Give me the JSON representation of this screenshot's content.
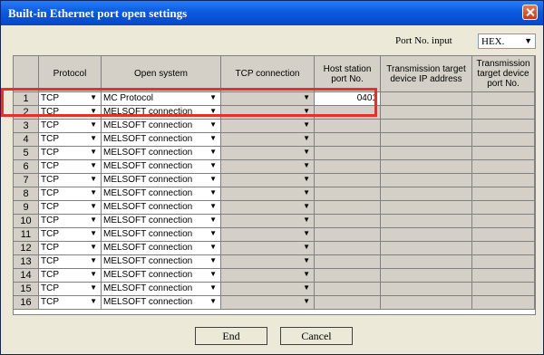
{
  "window": {
    "title": "Built-in Ethernet port open settings"
  },
  "port_no_input": {
    "label": "Port No. input",
    "value": "HEX."
  },
  "columns": [
    "",
    "Protocol",
    "Open system",
    "TCP connection",
    "Host station port No.",
    "Transmission target device IP address",
    "Transmission target device port No."
  ],
  "rows": [
    {
      "num": "1",
      "protocol": "TCP",
      "open_system": "MC Protocol",
      "tcp_connection": "",
      "host_port": "0401"
    },
    {
      "num": "2",
      "protocol": "TCP",
      "open_system": "MELSOFT connection",
      "tcp_connection": "",
      "host_port": ""
    },
    {
      "num": "3",
      "protocol": "TCP",
      "open_system": "MELSOFT connection",
      "tcp_connection": "",
      "host_port": ""
    },
    {
      "num": "4",
      "protocol": "TCP",
      "open_system": "MELSOFT connection",
      "tcp_connection": "",
      "host_port": ""
    },
    {
      "num": "5",
      "protocol": "TCP",
      "open_system": "MELSOFT connection",
      "tcp_connection": "",
      "host_port": ""
    },
    {
      "num": "6",
      "protocol": "TCP",
      "open_system": "MELSOFT connection",
      "tcp_connection": "",
      "host_port": ""
    },
    {
      "num": "7",
      "protocol": "TCP",
      "open_system": "MELSOFT connection",
      "tcp_connection": "",
      "host_port": ""
    },
    {
      "num": "8",
      "protocol": "TCP",
      "open_system": "MELSOFT connection",
      "tcp_connection": "",
      "host_port": ""
    },
    {
      "num": "9",
      "protocol": "TCP",
      "open_system": "MELSOFT connection",
      "tcp_connection": "",
      "host_port": ""
    },
    {
      "num": "10",
      "protocol": "TCP",
      "open_system": "MELSOFT connection",
      "tcp_connection": "",
      "host_port": ""
    },
    {
      "num": "11",
      "protocol": "TCP",
      "open_system": "MELSOFT connection",
      "tcp_connection": "",
      "host_port": ""
    },
    {
      "num": "12",
      "protocol": "TCP",
      "open_system": "MELSOFT connection",
      "tcp_connection": "",
      "host_port": ""
    },
    {
      "num": "13",
      "protocol": "TCP",
      "open_system": "MELSOFT connection",
      "tcp_connection": "",
      "host_port": ""
    },
    {
      "num": "14",
      "protocol": "TCP",
      "open_system": "MELSOFT connection",
      "tcp_connection": "",
      "host_port": ""
    },
    {
      "num": "15",
      "protocol": "TCP",
      "open_system": "MELSOFT connection",
      "tcp_connection": "",
      "host_port": ""
    },
    {
      "num": "16",
      "protocol": "TCP",
      "open_system": "MELSOFT connection",
      "tcp_connection": "",
      "host_port": ""
    }
  ],
  "buttons": {
    "end": "End",
    "cancel": "Cancel"
  },
  "colors": {
    "titlebar": "#0b5ae0",
    "highlight": "#e8302a",
    "dialog_bg": "#ece9d8",
    "disabled_cell": "#d4d0c8"
  },
  "icons": {
    "close": "close-icon",
    "dropdown": "chevron-down-icon"
  }
}
